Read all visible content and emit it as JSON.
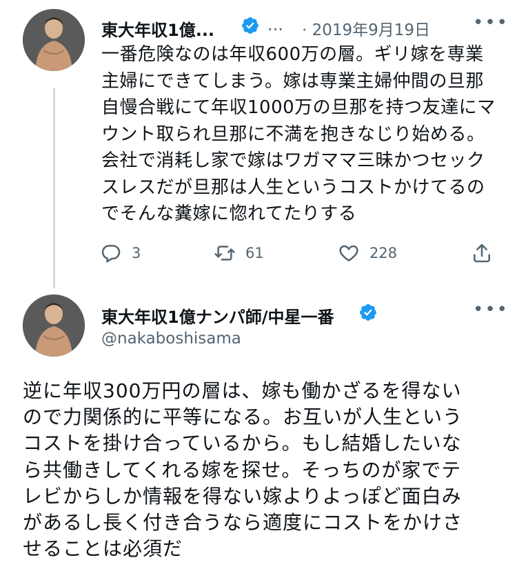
{
  "tweet1": {
    "author_name": "東大年収1億...",
    "handle_truncated": "...",
    "date": "· 2019年9月19日",
    "text_lines": [
      "一番危険なのは年収600万の層。ギリ嫁を専業",
      "主婦にできてしまう。嫁は専業主婦仲間の旦那",
      "自慢合戦にて年収1000万の旦那を持つ友達にマ",
      "ウント取られ旦那に不満を抱きなじり始める。",
      "会社で消耗し家で嫁はワガママ三昧かつセック",
      "スレスだが旦那は人生というコストかけてるの",
      "でそんな糞嫁に惚れてたりする"
    ],
    "replies": "3",
    "retweets": "61",
    "likes": "228",
    "icons": [
      "reply-icon",
      "retweet-icon",
      "like-icon",
      "share-icon"
    ]
  },
  "tweet2": {
    "author_name": "東大年収1億ナンパ師/中星一番",
    "handle": "@nakaboshisama",
    "text_lines": [
      "逆に年収300万円の層は、嫁も働かざるを得ない",
      "ので力関係的に平等になる。お互いが人生という",
      "コストを掛け合っているから。もし結婚したいな",
      "ら共働きしてくれる嫁を探せ。そっちのが家でテ",
      "レビからしか情報を得ない嫁よりよっぽど面白み",
      "があるし長く付き合うなら適度にコストをかけさ",
      "せることは必須だ"
    ]
  },
  "colors": {
    "verified": "#1d9bf0",
    "secondary_text": "#536471",
    "thread_line": "#cfd9de"
  }
}
